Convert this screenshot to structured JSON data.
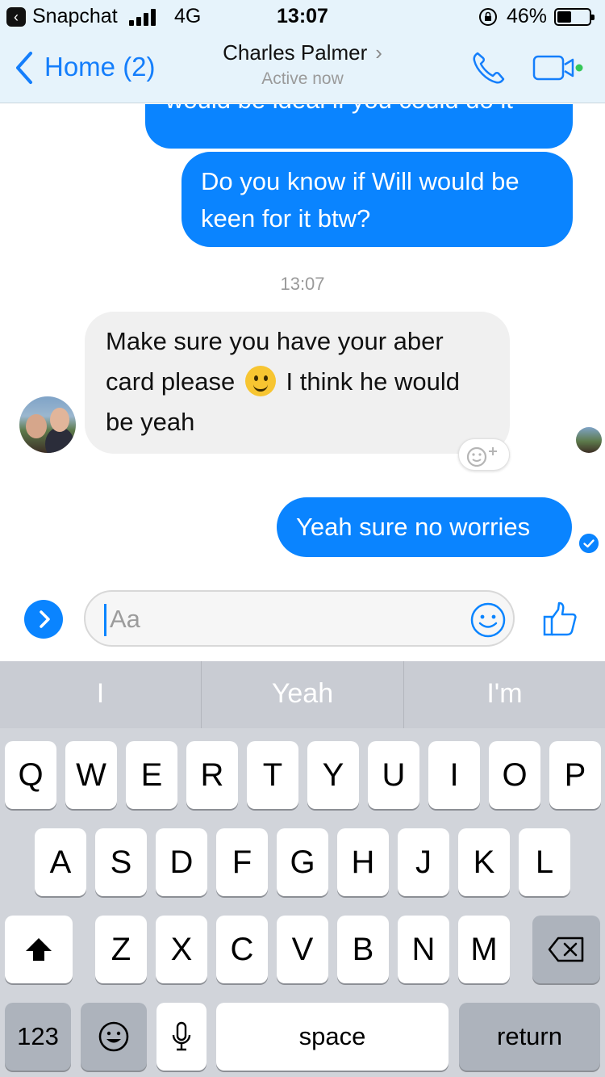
{
  "status_bar": {
    "back_app": "Snapchat",
    "network": "4G",
    "time": "13:07",
    "battery_percent": "46%",
    "battery_level": 0.46
  },
  "header": {
    "back_label": "Home (2)",
    "contact_name": "Charles Palmer",
    "contact_status": "Active now"
  },
  "messages": [
    {
      "sender": "me",
      "text": "would be ideal if you could do it"
    },
    {
      "sender": "me",
      "text": "Do you know if Will would be keen for it btw?"
    },
    {
      "sender": "them",
      "text_before_emoji": "Make sure you have your aber card please",
      "text_after_emoji": "I think he would be yeah"
    },
    {
      "sender": "me",
      "text": "Yeah sure no worries"
    }
  ],
  "timestamp": "13:07",
  "composer": {
    "placeholder": "Aa"
  },
  "suggestions": [
    "I",
    "Yeah",
    "I'm"
  ],
  "keyboard": {
    "row1": [
      "Q",
      "W",
      "E",
      "R",
      "T",
      "Y",
      "U",
      "I",
      "O",
      "P"
    ],
    "row2": [
      "A",
      "S",
      "D",
      "F",
      "G",
      "H",
      "J",
      "K",
      "L"
    ],
    "row3": [
      "Z",
      "X",
      "C",
      "V",
      "B",
      "N",
      "M"
    ],
    "numbers_label": "123",
    "space_label": "space",
    "return_label": "return"
  },
  "colors": {
    "accent": "#0a84ff",
    "header_bg": "#e6f3fb",
    "incoming_bubble": "#f0f0f0",
    "keyboard_bg": "#d1d4da"
  }
}
